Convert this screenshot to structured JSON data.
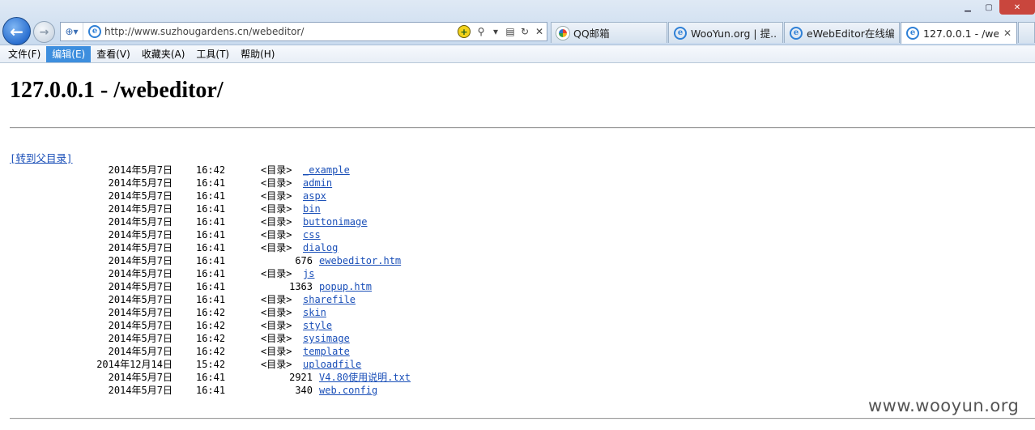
{
  "browser": {
    "address_url": "http://www.suzhougardens.cn/webeditor/",
    "tabs": [
      {
        "label": "QQ邮箱",
        "icon": "qq-icon"
      },
      {
        "label": "WooYun.org | 提...",
        "icon": "ie-icon"
      },
      {
        "label": "eWebEditor在线编...",
        "icon": "ie-icon"
      },
      {
        "label": "127.0.0.1 - /we...",
        "icon": "ie-icon",
        "active": true,
        "close": "✕"
      }
    ]
  },
  "menu": [
    "文件(F)",
    "编辑(E)",
    "查看(V)",
    "收藏夹(A)",
    "工具(T)",
    "帮助(H)"
  ],
  "page": {
    "title": "127.0.0.1 - /webeditor/",
    "parent_link": "[转到父目录]",
    "dir_marker": "<目录>",
    "entries": [
      {
        "date": "2014年5月7日",
        "time": "16:42",
        "dir": true,
        "name": "_example"
      },
      {
        "date": "2014年5月7日",
        "time": "16:41",
        "dir": true,
        "name": "admin"
      },
      {
        "date": "2014年5月7日",
        "time": "16:41",
        "dir": true,
        "name": "aspx"
      },
      {
        "date": "2014年5月7日",
        "time": "16:41",
        "dir": true,
        "name": "bin"
      },
      {
        "date": "2014年5月7日",
        "time": "16:41",
        "dir": true,
        "name": "buttonimage"
      },
      {
        "date": "2014年5月7日",
        "time": "16:41",
        "dir": true,
        "name": "css"
      },
      {
        "date": "2014年5月7日",
        "time": "16:41",
        "dir": true,
        "name": "dialog"
      },
      {
        "date": "2014年5月7日",
        "time": "16:41",
        "dir": false,
        "size": "676",
        "name": "ewebeditor.htm"
      },
      {
        "date": "2014年5月7日",
        "time": "16:41",
        "dir": true,
        "name": "js"
      },
      {
        "date": "2014年5月7日",
        "time": "16:41",
        "dir": false,
        "size": "1363",
        "name": "popup.htm"
      },
      {
        "date": "2014年5月7日",
        "time": "16:41",
        "dir": true,
        "name": "sharefile"
      },
      {
        "date": "2014年5月7日",
        "time": "16:42",
        "dir": true,
        "name": "skin"
      },
      {
        "date": "2014年5月7日",
        "time": "16:42",
        "dir": true,
        "name": "style"
      },
      {
        "date": "2014年5月7日",
        "time": "16:42",
        "dir": true,
        "name": "sysimage"
      },
      {
        "date": "2014年5月7日",
        "time": "16:42",
        "dir": true,
        "name": "template"
      },
      {
        "date": "2014年12月14日",
        "time": "15:42",
        "dir": true,
        "name": "uploadfile"
      },
      {
        "date": "2014年5月7日",
        "time": "16:41",
        "dir": false,
        "size": "2921",
        "name": "V4.80使用说明.txt"
      },
      {
        "date": "2014年5月7日",
        "time": "16:41",
        "dir": false,
        "size": "340",
        "name": "web.config"
      }
    ]
  },
  "watermark": "www.wooyun.org",
  "colors": {
    "link": "#1a4fb8",
    "menu_active": "#3d8ede"
  }
}
